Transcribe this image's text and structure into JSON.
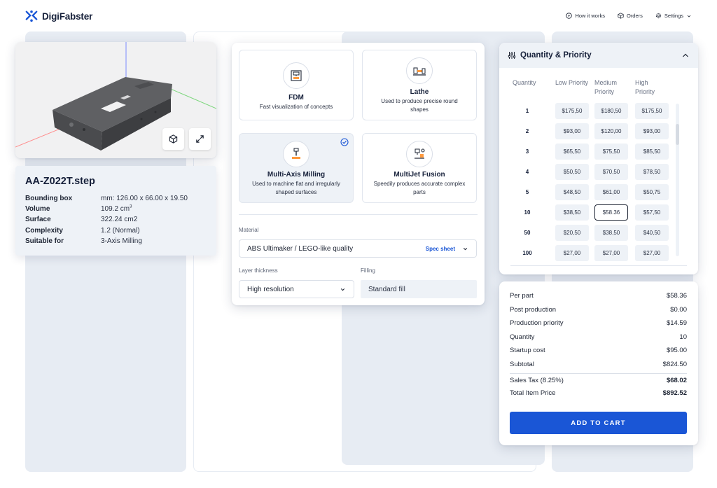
{
  "brand": {
    "name": "DigiFabster"
  },
  "nav": [
    {
      "label": "How it works",
      "icon": "play-circle-icon"
    },
    {
      "label": "Orders",
      "icon": "box-icon"
    },
    {
      "label": "Settings",
      "icon": "gear-icon"
    }
  ],
  "file": {
    "name": "AA-Z022T.step",
    "props": [
      {
        "key": "Bounding box",
        "value": "mm: 126.00 x 66.00 x 19.50"
      },
      {
        "key": "Volume",
        "value": "109.2 cm",
        "sup": "3"
      },
      {
        "key": "Surface",
        "value": "322.24 cm2"
      },
      {
        "key": "Complexity",
        "value": "1.2 (Normal)"
      },
      {
        "key": "Suitable for",
        "value": "3-Axis Milling"
      }
    ]
  },
  "technologies": [
    {
      "title": "FDM",
      "desc": "Fast visualization of concepts",
      "icon": "fdm-printer-icon",
      "selected": false
    },
    {
      "title": "Lathe",
      "desc": "Used to produce precise round shapes",
      "icon": "lathe-icon",
      "selected": false
    },
    {
      "title": "Multi-Axis Milling",
      "desc": "Used to machine flat and irregularly shaped surfaces",
      "icon": "milling-icon",
      "selected": true
    },
    {
      "title": "MultiJet Fusion",
      "desc": "Speedily produces accurate complex parts",
      "icon": "multijet-icon",
      "selected": false
    }
  ],
  "material": {
    "label": "Material",
    "value": "ABS Ultimaker / LEGO-like quality",
    "spec_link": "Spec sheet"
  },
  "layer": {
    "label": "Layer thickness",
    "value": "High resolution"
  },
  "filling": {
    "label": "Filling",
    "value": "Standard fill"
  },
  "quantity_priority": {
    "title": "Quantity & Priority",
    "headers": [
      "Quantity",
      "Low Priority",
      "Medium Priority",
      "High Priority"
    ],
    "rows": [
      {
        "qty": "1",
        "low": "$175,50",
        "medium": "$180,50",
        "high": "$175,50"
      },
      {
        "qty": "2",
        "low": "$93,00",
        "medium": "$120,00",
        "high": "$93,00"
      },
      {
        "qty": "3",
        "low": "$65,50",
        "medium": "$75,50",
        "high": "$85,50"
      },
      {
        "qty": "4",
        "low": "$50,50",
        "medium": "$70,50",
        "high": "$78,50"
      },
      {
        "qty": "5",
        "low": "$48,50",
        "medium": "$61,00",
        "high": "$50,75"
      },
      {
        "qty": "10",
        "low": "$38,50",
        "medium": "$58.36",
        "high": "$57,50"
      },
      {
        "qty": "50",
        "low": "$20,50",
        "medium": "$38,50",
        "high": "$40,50"
      },
      {
        "qty": "100",
        "low": "$27,00",
        "medium": "$27,00",
        "high": "$27,00"
      }
    ],
    "selected": {
      "row": 5,
      "col": "medium"
    }
  },
  "summary": {
    "rows": [
      {
        "label": "Per part",
        "value": "$58.36"
      },
      {
        "label": "Post production",
        "value": "$0.00"
      },
      {
        "label": "Production priority",
        "value": "$14.59"
      },
      {
        "label": "Quantity",
        "value": "10"
      },
      {
        "label": "Startup cost",
        "value": "$95.00"
      },
      {
        "label": "Subtotal",
        "value": "$824.50"
      }
    ],
    "tax": {
      "label": "Sales Tax (8.25%)",
      "value": "$68.02"
    },
    "total": {
      "label": "Total Item Price",
      "value": "$892.52"
    },
    "cta": "ADD TO CART"
  },
  "colors": {
    "accent": "#1a56d6",
    "panel_bg": "#e7ecf3",
    "text": "#1d2433"
  }
}
